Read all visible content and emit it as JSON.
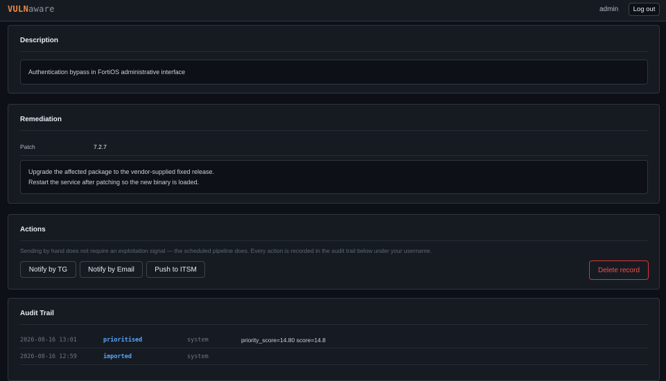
{
  "header": {
    "logo_bold": "VULN",
    "logo_rest": "aware",
    "username": "admin",
    "logout_label": "Log out"
  },
  "description": {
    "title": "Description",
    "text": "Authentication bypass in FortiOS administrative interface"
  },
  "remediation": {
    "title": "Remediation",
    "patch_label": "Patch",
    "patch_value": "7.2.7",
    "lines": [
      "Upgrade the affected package to the vendor-supplied fixed release.",
      "Restart the service after patching so the new binary is loaded."
    ]
  },
  "actions": {
    "title": "Actions",
    "hint": "Sending by hand does not require an exploitation signal — the scheduled pipeline does. Every action is recorded in the audit trail below under your username.",
    "notify_tg": "Notify by TG",
    "notify_email": "Notify by Email",
    "push_itsm": "Push to ITSM",
    "delete": "Delete record"
  },
  "audit": {
    "title": "Audit Trail",
    "rows": [
      {
        "ts": "2026-08-16 13:01",
        "event": "prioritised",
        "actor": "system",
        "details": "priority_score=14.80  score=14.8"
      },
      {
        "ts": "2026-08-16 12:59",
        "event": "imported",
        "actor": "system",
        "details": ""
      }
    ]
  },
  "colors": {
    "accent": "#f0883e",
    "link": "#58a6ff",
    "danger": "#f85149",
    "background": "#0d1117",
    "card": "#161b22"
  }
}
